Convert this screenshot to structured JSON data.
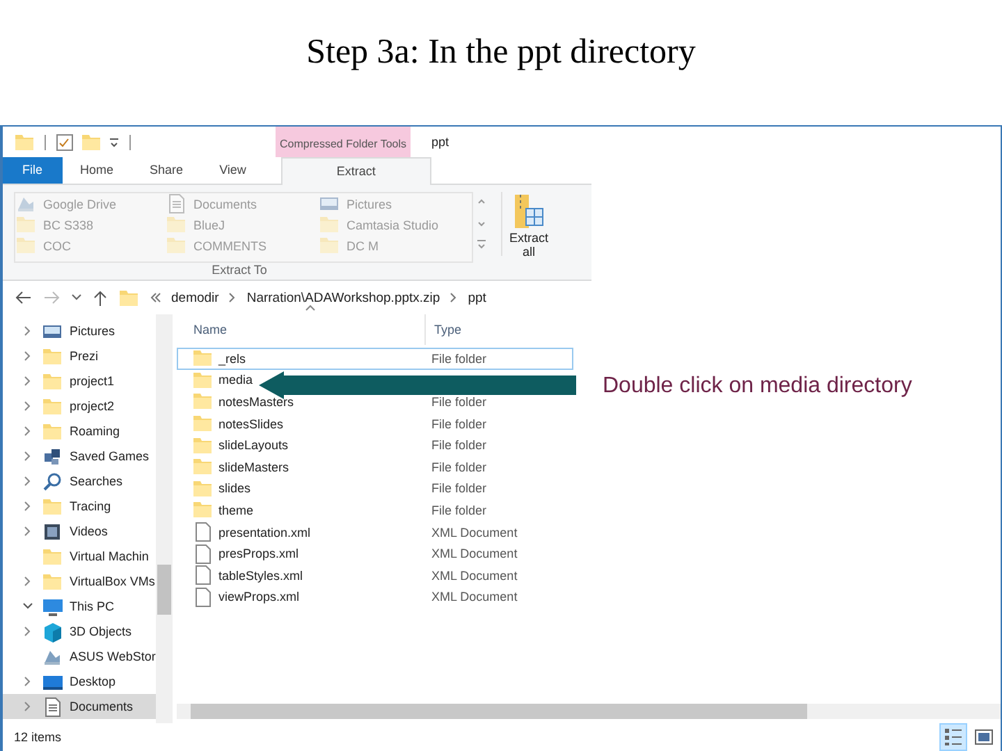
{
  "slide": {
    "title": "Step 3a: In the ppt directory",
    "callout": "Double click on media directory"
  },
  "window": {
    "title": "ppt",
    "context_tab_group": "Compressed Folder Tools"
  },
  "ribbon": {
    "tabs": [
      {
        "label": "File",
        "kind": "file",
        "selected": false
      },
      {
        "label": "Home",
        "kind": "tab",
        "selected": false
      },
      {
        "label": "Share",
        "kind": "tab",
        "selected": false
      },
      {
        "label": "View",
        "kind": "tab",
        "selected": false
      },
      {
        "label": "Extract",
        "kind": "context",
        "selected": true
      }
    ],
    "destinations": [
      {
        "label": "Google Drive",
        "kind": "drive"
      },
      {
        "label": "BC S338",
        "kind": "folder"
      },
      {
        "label": "COC",
        "kind": "folder"
      },
      {
        "label": "Documents",
        "kind": "documents"
      },
      {
        "label": "BlueJ",
        "kind": "folder"
      },
      {
        "label": "COMMENTS",
        "kind": "folder"
      },
      {
        "label": "Pictures",
        "kind": "pictures"
      },
      {
        "label": "Camtasia Studio",
        "kind": "folder"
      },
      {
        "label": "DC M",
        "kind": "folder"
      }
    ],
    "group_label": "Extract To",
    "extract_all": "Extract all"
  },
  "address": {
    "path": [
      "demodir",
      "Narration\\ADAWorkshop.pptx.zip",
      "ppt"
    ]
  },
  "sidebar": {
    "items": [
      {
        "label": "Pictures",
        "kind": "pictures",
        "expanded": false,
        "selected": false
      },
      {
        "label": "Prezi",
        "kind": "folder",
        "expanded": false,
        "selected": false
      },
      {
        "label": "project1",
        "kind": "folder",
        "expanded": false,
        "selected": false
      },
      {
        "label": "project2",
        "kind": "folder",
        "expanded": false,
        "selected": false
      },
      {
        "label": "Roaming",
        "kind": "folder",
        "expanded": false,
        "selected": false
      },
      {
        "label": "Saved Games",
        "kind": "games",
        "expanded": false,
        "selected": false
      },
      {
        "label": "Searches",
        "kind": "search",
        "expanded": false,
        "selected": false
      },
      {
        "label": "Tracing",
        "kind": "folder",
        "expanded": false,
        "selected": false
      },
      {
        "label": "Videos",
        "kind": "videos",
        "expanded": false,
        "selected": false
      },
      {
        "label": "Virtual Machin",
        "kind": "folder",
        "selected": false
      },
      {
        "label": "VirtualBox VMs",
        "kind": "folder",
        "expanded": false,
        "selected": false
      },
      {
        "label": "This PC",
        "kind": "pc",
        "expanded": true,
        "selected": false,
        "children": [
          {
            "label": "3D Objects",
            "kind": "cube",
            "expanded": false,
            "selected": false
          },
          {
            "label": "ASUS WebStor",
            "kind": "drive",
            "selected": false
          },
          {
            "label": "Desktop",
            "kind": "desktop",
            "expanded": false,
            "selected": false
          },
          {
            "label": "Documents",
            "kind": "documents",
            "expanded": false,
            "selected": true
          }
        ]
      }
    ]
  },
  "files": {
    "columns": [
      "Name",
      "Type"
    ],
    "rows": [
      {
        "name": "_rels",
        "type": "File folder",
        "kind": "folder",
        "focused": true
      },
      {
        "name": "media",
        "kind": "folder",
        "focused": false
      },
      {
        "name": "notesMasters",
        "type": "File folder",
        "kind": "folder",
        "focused": false
      },
      {
        "name": "notesSlides",
        "type": "File folder",
        "kind": "folder",
        "focused": false
      },
      {
        "name": "slideLayouts",
        "type": "File folder",
        "kind": "folder",
        "focused": false
      },
      {
        "name": "slideMasters",
        "type": "File folder",
        "kind": "folder",
        "focused": false
      },
      {
        "name": "slides",
        "type": "File folder",
        "kind": "folder",
        "focused": false
      },
      {
        "name": "theme",
        "type": "File folder",
        "kind": "folder",
        "focused": false
      },
      {
        "name": "presentation.xml",
        "type": "XML Document",
        "kind": "file",
        "focused": false
      },
      {
        "name": "presProps.xml",
        "type": "XML Document",
        "kind": "file",
        "focused": false
      },
      {
        "name": "tableStyles.xml",
        "type": "XML Document",
        "kind": "file",
        "focused": false
      },
      {
        "name": "viewProps.xml",
        "type": "XML Document",
        "kind": "file",
        "focused": false
      }
    ]
  },
  "status_bar": {
    "count": "12 items",
    "views": [
      {
        "kind": "details",
        "selected": true
      },
      {
        "kind": "large",
        "selected": false
      }
    ]
  }
}
